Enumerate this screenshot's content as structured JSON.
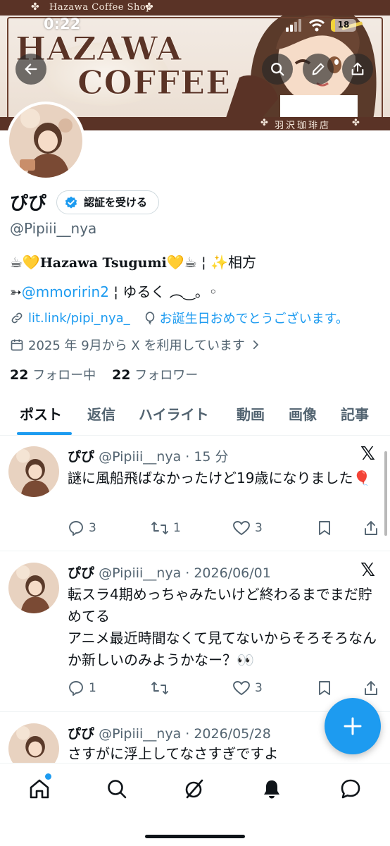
{
  "status_bar": {
    "time": "0:22",
    "battery": "18",
    "battery_fraction": 0.18
  },
  "banner": {
    "shop_label": "Hazawa Coffee Shop",
    "title_line1": "HAZAWA",
    "title_line2": "COFFEE",
    "jp_label": "羽沢珈琲店",
    "clover": "✤"
  },
  "header_buttons": [
    "back-arrow-icon",
    "search-icon",
    "edit-icon",
    "share-icon"
  ],
  "profile": {
    "display_name": "ぴぴ",
    "verify_label": "認証を受ける",
    "handle": "@Pipiii__nya",
    "bio_line1_prefix": "☕💛",
    "bio_line1_name": "Hazawa Tsugumi",
    "bio_line1_suffix": "💛☕ ¦ ✨相方",
    "bio_line2_prefix": "➳",
    "bio_line2_mention": "@mmoririn2",
    "bio_line2_suffix": " ¦ ゆるく ︵‿。◦",
    "link": "lit.link/pipi_nya_",
    "birthday": "お誕生日おめでとうございます。",
    "joined": "2025 年 9月から X を利用しています",
    "following_count": "22",
    "following_label": "フォロー中",
    "followers_count": "22",
    "followers_label": "フォロワー"
  },
  "tabs": [
    "ポスト",
    "返信",
    "ハイライト",
    "動画",
    "画像",
    "記事"
  ],
  "active_tab": 0,
  "posts": [
    {
      "name": "ぴぴ",
      "meta": "@Pipiii__nya · 15 分",
      "text": "謎に風船飛ばなかったけど19歳になりました🎈",
      "replies": "3",
      "reposts": "1",
      "likes": "3"
    },
    {
      "name": "ぴぴ",
      "meta": "@Pipiii__nya · 2026/06/01",
      "text": "転スラ4期めっちゃみたいけど終わるまでまだ貯めてる\nアニメ最近時間なくて見てないからそろそろなんか新しいのみようかなー？👀",
      "replies": "1",
      "reposts": "",
      "likes": "3"
    },
    {
      "name": "ぴぴ",
      "meta": "@Pipiii__nya · 2026/05/28",
      "text": "さすがに浮上してなさすぎですよ"
    }
  ],
  "x_logo": "𝕏",
  "fab_label": "+",
  "bottom_nav": [
    "home-icon",
    "search-icon",
    "grok-icon",
    "notifications-icon",
    "messages-icon"
  ],
  "colors": {
    "accent": "#1d9bf0",
    "banner_brown": "#5a3326",
    "text": "#0f1419",
    "muted": "#536471"
  }
}
